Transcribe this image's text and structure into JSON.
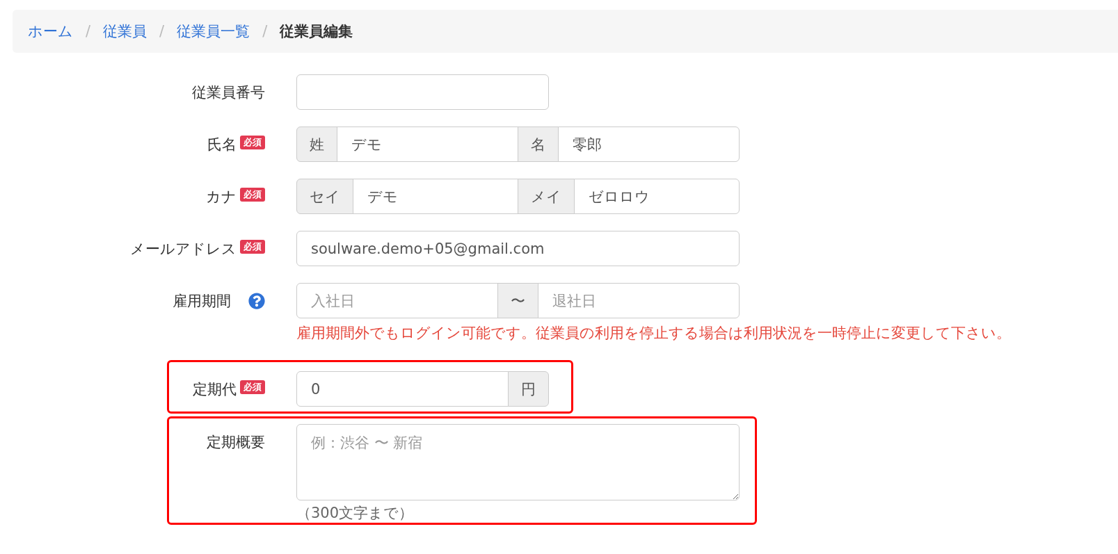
{
  "breadcrumb": [
    {
      "kind": "link",
      "label": "ホーム"
    },
    {
      "kind": "separator",
      "label": "/"
    },
    {
      "kind": "link",
      "label": "従業員"
    },
    {
      "kind": "separator",
      "label": "/"
    },
    {
      "kind": "link",
      "label": "従業員一覧"
    },
    {
      "kind": "separator",
      "label": "/"
    },
    {
      "kind": "current",
      "label": "従業員編集"
    }
  ],
  "form": {
    "rows": [
      {
        "kind": "short",
        "label": "従業員番号",
        "help_icon": false,
        "highlighted": false
      },
      {
        "kind": "split",
        "label": "氏名",
        "badge": "必須",
        "help_icon": false,
        "highlighted": false,
        "parts": [
          {
            "addon": "姓",
            "value": "デモ"
          },
          {
            "addon": "名",
            "value": "零郎"
          }
        ]
      },
      {
        "kind": "split",
        "label": "カナ",
        "badge": "必須",
        "help_icon": false,
        "highlighted": false,
        "parts": [
          {
            "addon": "セイ",
            "value": "デモ"
          },
          {
            "addon": "メイ",
            "value": "ゼロロウ"
          }
        ]
      },
      {
        "kind": "text",
        "label": "メールアドレス",
        "badge": "必須",
        "help_icon": false,
        "highlighted": false,
        "value": "soulware.demo+05@gmail.com"
      },
      {
        "kind": "range",
        "label": "雇用期間",
        "help_icon": true,
        "highlighted": false,
        "start": {
          "placeholder": "入社日"
        },
        "addon": "〜",
        "end": {
          "placeholder": "退社日"
        },
        "note": "雇用期間外でもログイン可能です。従業員の利用を停止する場合は利用状況を一時停止に変更して下さい。"
      },
      {
        "kind": "suffix",
        "label": "定期代",
        "badge": "必須",
        "help_icon": false,
        "highlighted": true,
        "value": "0",
        "addon": "円"
      },
      {
        "kind": "textarea",
        "label": "定期概要",
        "help_icon": false,
        "highlighted": true,
        "placeholder": "例：渋谷 〜 新宿",
        "hint": "（300文字まで）"
      }
    ]
  }
}
